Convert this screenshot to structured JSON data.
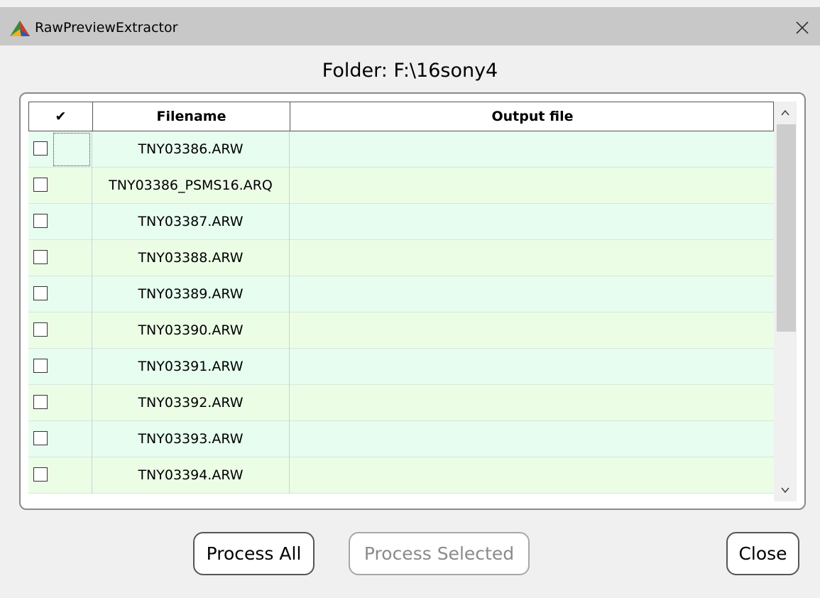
{
  "window": {
    "title": "RawPreviewExtractor",
    "icon": "app-icon",
    "close_icon": "close-icon"
  },
  "folder_label": "Folder: F:\\16sony4",
  "table": {
    "headers": {
      "check": "✔",
      "filename": "Filename",
      "output": "Output file"
    },
    "rows": [
      {
        "checked": false,
        "filename": "TNY03386.ARW",
        "output": ""
      },
      {
        "checked": false,
        "filename": "TNY03386_PSMS16.ARQ",
        "output": ""
      },
      {
        "checked": false,
        "filename": "TNY03387.ARW",
        "output": ""
      },
      {
        "checked": false,
        "filename": "TNY03388.ARW",
        "output": ""
      },
      {
        "checked": false,
        "filename": "TNY03389.ARW",
        "output": ""
      },
      {
        "checked": false,
        "filename": "TNY03390.ARW",
        "output": ""
      },
      {
        "checked": false,
        "filename": "TNY03391.ARW",
        "output": ""
      },
      {
        "checked": false,
        "filename": "TNY03392.ARW",
        "output": ""
      },
      {
        "checked": false,
        "filename": "TNY03393.ARW",
        "output": ""
      },
      {
        "checked": false,
        "filename": "TNY03394.ARW",
        "output": ""
      }
    ],
    "row_colors": [
      "#e6fdf0",
      "#ecfde6"
    ]
  },
  "buttons": {
    "process_all": "Process All",
    "process_selected": "Process Selected",
    "close": "Close"
  }
}
